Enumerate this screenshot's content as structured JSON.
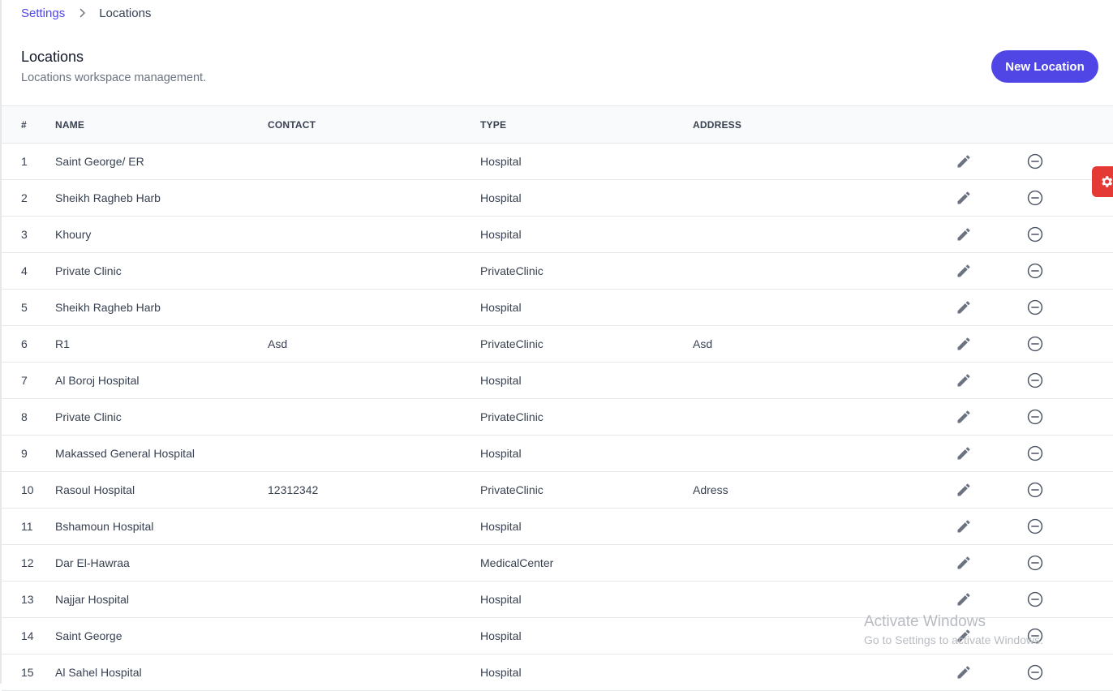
{
  "breadcrumb": {
    "root": "Settings",
    "current": "Locations"
  },
  "header": {
    "title": "Locations",
    "subtitle": "Locations workspace management.",
    "new_button": "New Location"
  },
  "table": {
    "columns": {
      "num": "#",
      "name": "NAME",
      "contact": "CONTACT",
      "type": "TYPE",
      "address": "ADDRESS"
    },
    "rows": [
      {
        "num": "1",
        "name": "Saint George/ ER",
        "contact": "",
        "type": "Hospital",
        "address": ""
      },
      {
        "num": "2",
        "name": "Sheikh Ragheb Harb",
        "contact": "",
        "type": "Hospital",
        "address": ""
      },
      {
        "num": "3",
        "name": "Khoury",
        "contact": "",
        "type": "Hospital",
        "address": ""
      },
      {
        "num": "4",
        "name": "Private Clinic",
        "contact": "",
        "type": "PrivateClinic",
        "address": ""
      },
      {
        "num": "5",
        "name": "Sheikh Ragheb Harb",
        "contact": "",
        "type": "Hospital",
        "address": ""
      },
      {
        "num": "6",
        "name": "R1",
        "contact": "Asd",
        "type": "PrivateClinic",
        "address": "Asd"
      },
      {
        "num": "7",
        "name": "Al Boroj Hospital",
        "contact": "",
        "type": "Hospital",
        "address": ""
      },
      {
        "num": "8",
        "name": "Private Clinic",
        "contact": "",
        "type": "PrivateClinic",
        "address": ""
      },
      {
        "num": "9",
        "name": "Makassed General Hospital",
        "contact": "",
        "type": "Hospital",
        "address": ""
      },
      {
        "num": "10",
        "name": "Rasoul Hospital",
        "contact": "12312342",
        "type": "PrivateClinic",
        "address": "Adress"
      },
      {
        "num": "11",
        "name": "Bshamoun Hospital",
        "contact": "",
        "type": "Hospital",
        "address": ""
      },
      {
        "num": "12",
        "name": "Dar El-Hawraa",
        "contact": "",
        "type": "MedicalCenter",
        "address": ""
      },
      {
        "num": "13",
        "name": "Najjar Hospital",
        "contact": "",
        "type": "Hospital",
        "address": ""
      },
      {
        "num": "14",
        "name": "Saint George",
        "contact": "",
        "type": "Hospital",
        "address": ""
      },
      {
        "num": "15",
        "name": "Al Sahel Hospital",
        "contact": "",
        "type": "Hospital",
        "address": ""
      }
    ],
    "row_icons": {
      "edit": "pencil-icon",
      "delete": "minus-circle-icon"
    }
  },
  "floating": {
    "settings_icon": "gear-icon"
  },
  "watermark": {
    "title": "Activate Windows",
    "subtitle": "Go to Settings to activate Windows."
  },
  "colors": {
    "accent": "#4f46e5",
    "settings_tab": "#e53935",
    "icon": "#6b7280"
  }
}
